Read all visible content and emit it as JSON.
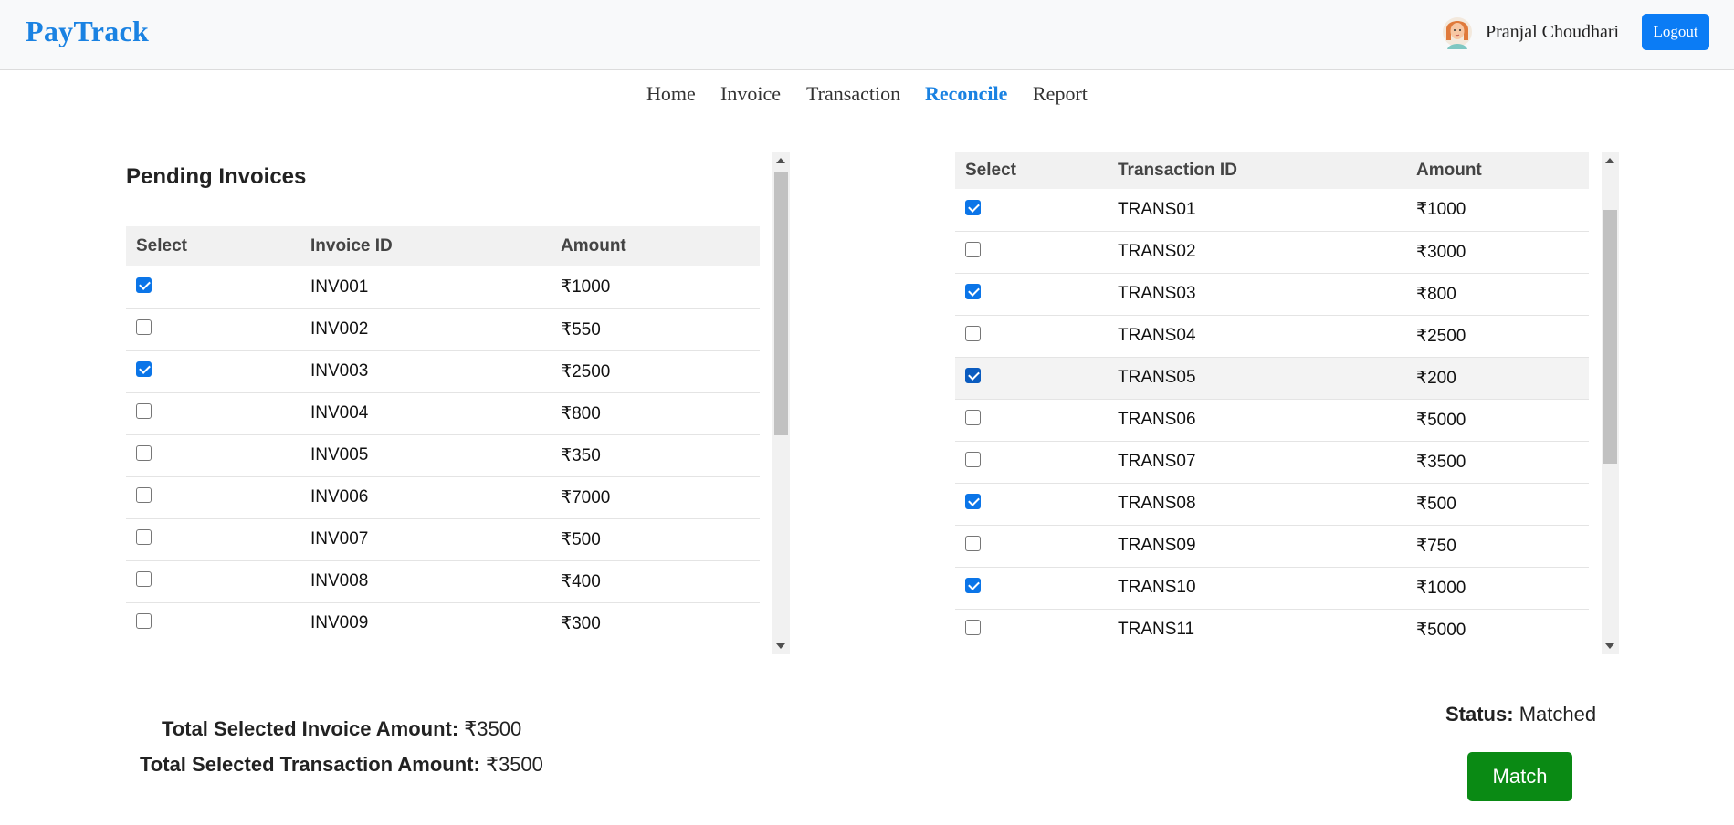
{
  "app": {
    "brand": "PayTrack"
  },
  "user": {
    "name": "Pranjal Choudhari",
    "logout_label": "Logout"
  },
  "nav": {
    "items": [
      {
        "label": "Home",
        "active": false
      },
      {
        "label": "Invoice",
        "active": false
      },
      {
        "label": "Transaction",
        "active": false
      },
      {
        "label": "Reconcile",
        "active": true
      },
      {
        "label": "Report",
        "active": false
      }
    ]
  },
  "invoices": {
    "title": "Pending Invoices",
    "columns": [
      "Select",
      "Invoice ID",
      "Amount"
    ],
    "rows": [
      {
        "id": "INV001",
        "amount": "₹1000",
        "checked": true
      },
      {
        "id": "INV002",
        "amount": "₹550",
        "checked": false
      },
      {
        "id": "INV003",
        "amount": "₹2500",
        "checked": true
      },
      {
        "id": "INV004",
        "amount": "₹800",
        "checked": false
      },
      {
        "id": "INV005",
        "amount": "₹350",
        "checked": false
      },
      {
        "id": "INV006",
        "amount": "₹7000",
        "checked": false
      },
      {
        "id": "INV007",
        "amount": "₹500",
        "checked": false
      },
      {
        "id": "INV008",
        "amount": "₹400",
        "checked": false
      },
      {
        "id": "INV009",
        "amount": "₹300",
        "checked": false
      }
    ]
  },
  "transactions": {
    "columns": [
      "Select",
      "Transaction ID",
      "Amount"
    ],
    "rows": [
      {
        "id": "TRANS01",
        "amount": "₹1000",
        "checked": true
      },
      {
        "id": "TRANS02",
        "amount": "₹3000",
        "checked": false
      },
      {
        "id": "TRANS03",
        "amount": "₹800",
        "checked": true
      },
      {
        "id": "TRANS04",
        "amount": "₹2500",
        "checked": false
      },
      {
        "id": "TRANS05",
        "amount": "₹200",
        "checked": true,
        "hovered": true
      },
      {
        "id": "TRANS06",
        "amount": "₹5000",
        "checked": false
      },
      {
        "id": "TRANS07",
        "amount": "₹3500",
        "checked": false
      },
      {
        "id": "TRANS08",
        "amount": "₹500",
        "checked": true
      },
      {
        "id": "TRANS09",
        "amount": "₹750",
        "checked": false
      },
      {
        "id": "TRANS10",
        "amount": "₹1000",
        "checked": true
      },
      {
        "id": "TRANS11",
        "amount": "₹5000",
        "checked": false
      }
    ]
  },
  "totals": {
    "invoice_label": "Total Selected Invoice Amount:",
    "invoice_value": "₹3500",
    "transaction_label": "Total Selected Transaction Amount:",
    "transaction_value": "₹3500"
  },
  "status": {
    "label": "Status:",
    "value": "Matched"
  },
  "match_button": "Match",
  "colors": {
    "brand": "#1a82e2",
    "logout": "#0b7cf5",
    "match": "#0a8a14",
    "checkbox": "#0b75e8"
  }
}
